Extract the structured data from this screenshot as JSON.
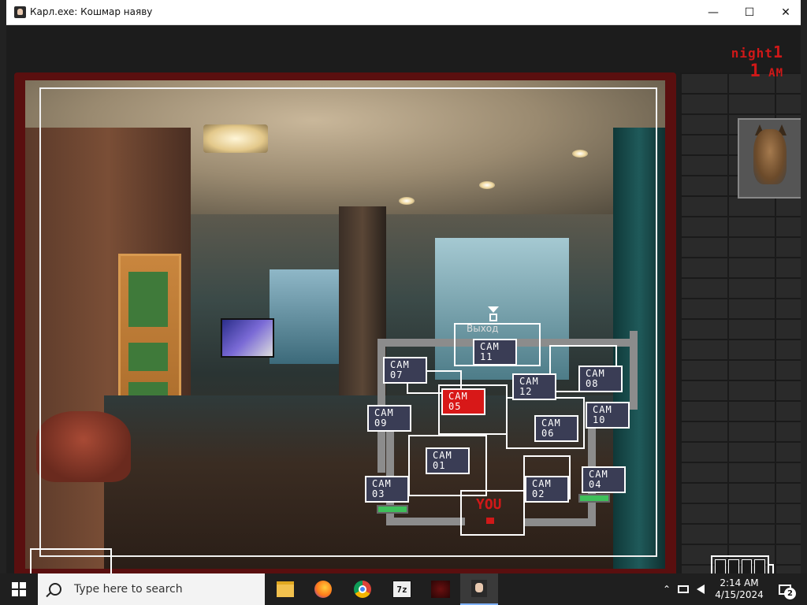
{
  "window": {
    "title": "Карл.exe: Кошмар наяву",
    "min_label": "—",
    "max_label": "☐",
    "close_label": "✕"
  },
  "hud": {
    "night_label": "night",
    "night_number": "1",
    "hour": "1",
    "period": "AM"
  },
  "map": {
    "exit_label": "Выход",
    "you_label": "YOU",
    "active_camera": "05",
    "cameras": [
      {
        "line1": "CAM",
        "line2": "11"
      },
      {
        "line1": "CAM",
        "line2": "07"
      },
      {
        "line1": "CAM",
        "line2": "05"
      },
      {
        "line1": "CAM",
        "line2": "12"
      },
      {
        "line1": "CAM",
        "line2": "08"
      },
      {
        "line1": "CAM",
        "line2": "09"
      },
      {
        "line1": "CAM",
        "line2": "06"
      },
      {
        "line1": "CAM",
        "line2": "10"
      },
      {
        "line1": "CAM",
        "line2": "01"
      },
      {
        "line1": "CAM",
        "line2": "03"
      },
      {
        "line1": "CAM",
        "line2": "02"
      },
      {
        "line1": "CAM",
        "line2": "04"
      }
    ]
  },
  "taskbar": {
    "search_placeholder": "Type here to search",
    "time": "2:14 AM",
    "date": "4/15/2024",
    "notification_count": "2",
    "sevenzip_label": "7z",
    "chevron": "⌃"
  },
  "colors": {
    "night_text": "#d01818",
    "active_cam": "#d81818",
    "cam_bg": "#3a3d55"
  }
}
